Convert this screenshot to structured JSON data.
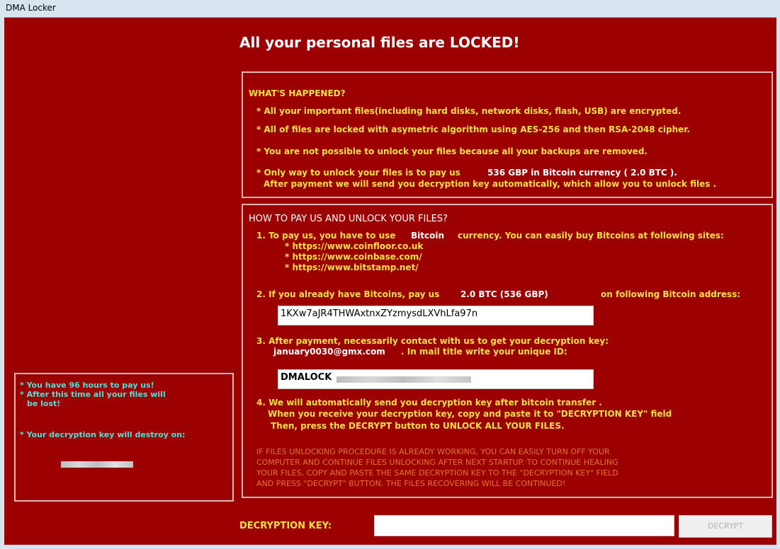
{
  "window": {
    "title": "DMA Locker"
  },
  "headline": "All your personal files are LOCKED!",
  "happened": {
    "heading": "WHAT'S HAPPENED?",
    "lines": [
      "* All your important files(including hard disks, network disks, flash, USB) are encrypted.",
      "* All of files are locked with asymetric algorithm using AES-256 and then RSA-2048 cipher.",
      "* You are not possible to unlock your files because all your backups are removed.",
      "* Only way to unlock your files is to pay us",
      "536 GBP in Bitcoin currency ( 2.0 BTC ).",
      "After payment we will send you decryption key automatically, which allow you to unlock files ."
    ]
  },
  "howto": {
    "heading": "HOW TO PAY US AND UNLOCK YOUR FILES?",
    "step1": "1. To pay us, you have to use",
    "step1_word": "Bitcoin",
    "step1_rest": "currency. You can easily buy Bitcoins at following sites:",
    "sites": [
      "* https://www.coinfloor.co.uk",
      "* https://www.coinbase.com/",
      "* https://www.bitstamp.net/"
    ],
    "step2": "2. If you already have Bitcoins, pay us",
    "step2_amount": "2.0 BTC (536 GBP)",
    "step2_rest": "on following Bitcoin address:",
    "address": "1KXw7aJR4THWAxtnxZYzmysdLXVhLfa97n",
    "step3": "3. After payment, necessarily contact with us to get your decryption key:",
    "email": "january0030@gmx.com",
    "step3_rest": ". In mail title write your unique ID:",
    "id_prefix": "DMALOCK",
    "step4_lines": [
      "4. We will automatically send you decryption key after bitcoin transfer .",
      "When you receive your decryption key, copy and paste it to  \"DECRYPTION KEY\"  field",
      "Then,  press the DECRYPT button to UNLOCK ALL YOUR FILES."
    ],
    "note_lines": [
      "IF FILES UNLOCKING PROCEDURE IS ALREADY WORKING, YOU CAN EASILY TURN OFF YOUR",
      "COMPUTER AND CONTINUE FILES UNLOCKING AFTER NEXT STARTUP. TO CONTINUE HEALING",
      "YOUR FILES, COPY AND PASTE THE SAME DECRYPTION KEY TO THE \"DECRYPTION  KEY\" FIELD",
      "AND PRESS \"DECRYPT\" BUTTON. THE FILES RECOVERING WILL BE CONTINUED!"
    ]
  },
  "left_panel": {
    "lines": [
      "* You have 96 hours to pay us!",
      "* After this time all your files will",
      "be lost!",
      "* Your decryption key will destroy on:"
    ]
  },
  "bottom": {
    "key_label": "DECRYPTION KEY:",
    "decrypt_button": "DECRYPT"
  },
  "colors": {
    "background": "#9c0101",
    "yellow": "#f5e046",
    "cyan": "#4fe1d6",
    "orange": "#e0742e"
  }
}
